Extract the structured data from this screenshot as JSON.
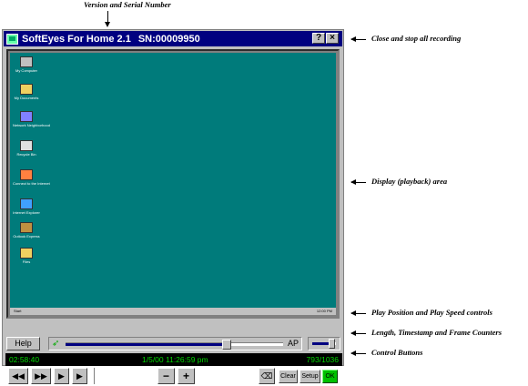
{
  "annotations": {
    "version": "Version and Serial Number",
    "close": "Close and stop all recording",
    "display": "Display (playback) area",
    "play_controls": "Play Position and Play Speed controls",
    "counters": "Length, Timestamp and Frame Counters",
    "control_buttons": "Control Buttons"
  },
  "window": {
    "title": "SoftEyes For Home 2.1",
    "serial": "SN:00009950",
    "help_btn": "?",
    "close_btn": "×"
  },
  "desktop": {
    "icons": [
      {
        "label": "My Computer",
        "icon": "computer-icon"
      },
      {
        "label": "My Documents",
        "icon": "folder-icon"
      },
      {
        "label": "Network Neighborhood",
        "icon": "network-icon"
      },
      {
        "label": "Recycle Bin",
        "icon": "recycle-bin-icon"
      },
      {
        "label": "Connect to the Internet",
        "icon": "globe-icon"
      },
      {
        "label": "Internet Explorer",
        "icon": "ie-icon"
      },
      {
        "label": "Outlook Express",
        "icon": "mail-icon"
      },
      {
        "label": "Files",
        "icon": "folder-icon"
      }
    ],
    "taskbar_left": "Start",
    "taskbar_right": "12:00 PM"
  },
  "controls": {
    "help": "Help",
    "position_level": 0.74,
    "speed_level": 0.85,
    "rocket_icon": "rocket-icon",
    "ap_label": "AP"
  },
  "status": {
    "length": "02:58:40",
    "timestamp": "1/5/00  11:26:59 pm",
    "frames": "793/1036"
  },
  "buttons": {
    "rewind": "◀◀",
    "fast_forward": "▶▶",
    "play": "▶",
    "step": "▶",
    "minus": "−",
    "plus": "+",
    "clear": "Clear",
    "setup": "Setup",
    "ok": "OK"
  }
}
